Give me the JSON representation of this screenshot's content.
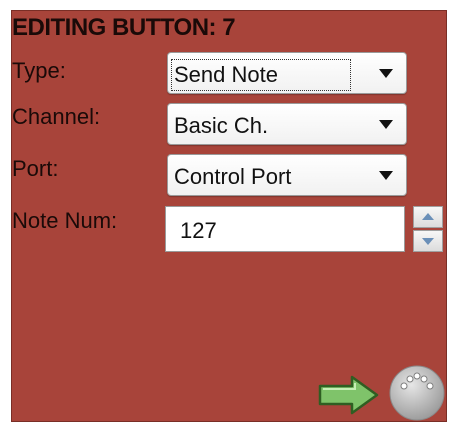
{
  "panel": {
    "title": "EDITING BUTTON: 7",
    "background_color": "#a8443a"
  },
  "fields": {
    "type": {
      "label": "Type:",
      "value": "Send Note"
    },
    "channel": {
      "label": "Channel:",
      "value": "Basic Ch."
    },
    "port": {
      "label": "Port:",
      "value": "Control Port"
    },
    "note_num": {
      "label": "Note Num:",
      "value": "127"
    }
  },
  "icons": {
    "send": "green-arrow-right-icon",
    "midi": "midi-connector-icon",
    "spin_up": "spin-up-icon",
    "spin_down": "spin-down-icon"
  },
  "colors": {
    "arrow_green": "#7fc36a",
    "connector_gray": "#bcbcbc"
  }
}
